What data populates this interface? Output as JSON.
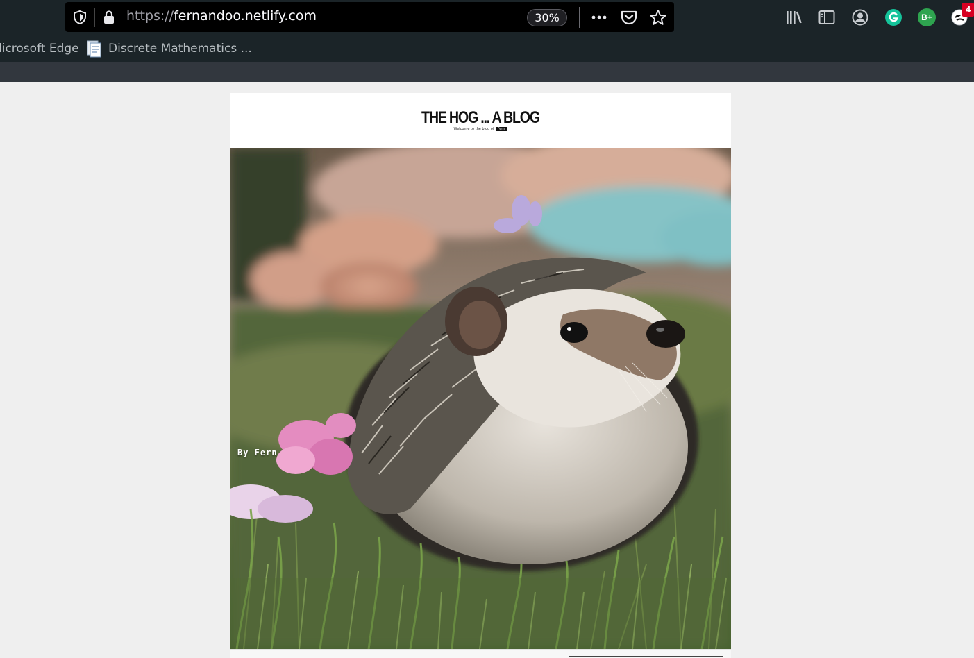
{
  "browser": {
    "url_protocol": "https://",
    "url_host": "fernandoo.netlify.com",
    "zoom_level": "30%",
    "notification_count": "4",
    "extension_label_bplus": "B+",
    "bookmarks": [
      {
        "label": "licrosoft Edge"
      },
      {
        "label": "Discrete Mathematics ..."
      }
    ]
  },
  "blog": {
    "title": "THE HOG ... A BLOG",
    "subtitle_prefix": "Welcome to the blog of",
    "subtitle_tag": "Fern",
    "byline": "By Fern"
  },
  "colors": {
    "chrome_bg": "#1b2428",
    "urlbar_bg": "#000000",
    "page_bg": "#efefef",
    "grammarly_green": "#15c39a",
    "bplus_green": "#2ea44f",
    "badge_red": "#d70022"
  }
}
